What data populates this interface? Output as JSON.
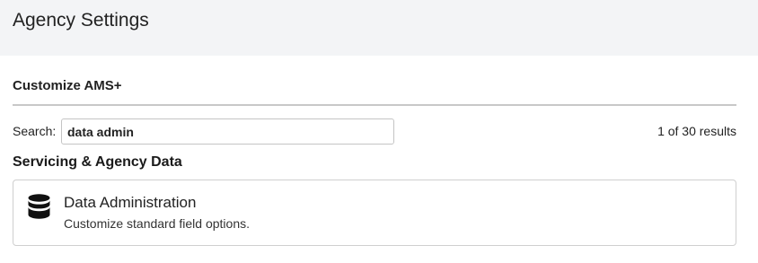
{
  "header": {
    "title": "Agency Settings"
  },
  "section": {
    "heading": "Customize AMS+"
  },
  "search": {
    "label": "Search:",
    "value": "data admin",
    "results_text": "1 of 30 results"
  },
  "category": {
    "heading": "Servicing & Agency Data"
  },
  "results": [
    {
      "icon": "database-icon",
      "title": "Data Administration",
      "description": "Customize standard field options."
    }
  ]
}
